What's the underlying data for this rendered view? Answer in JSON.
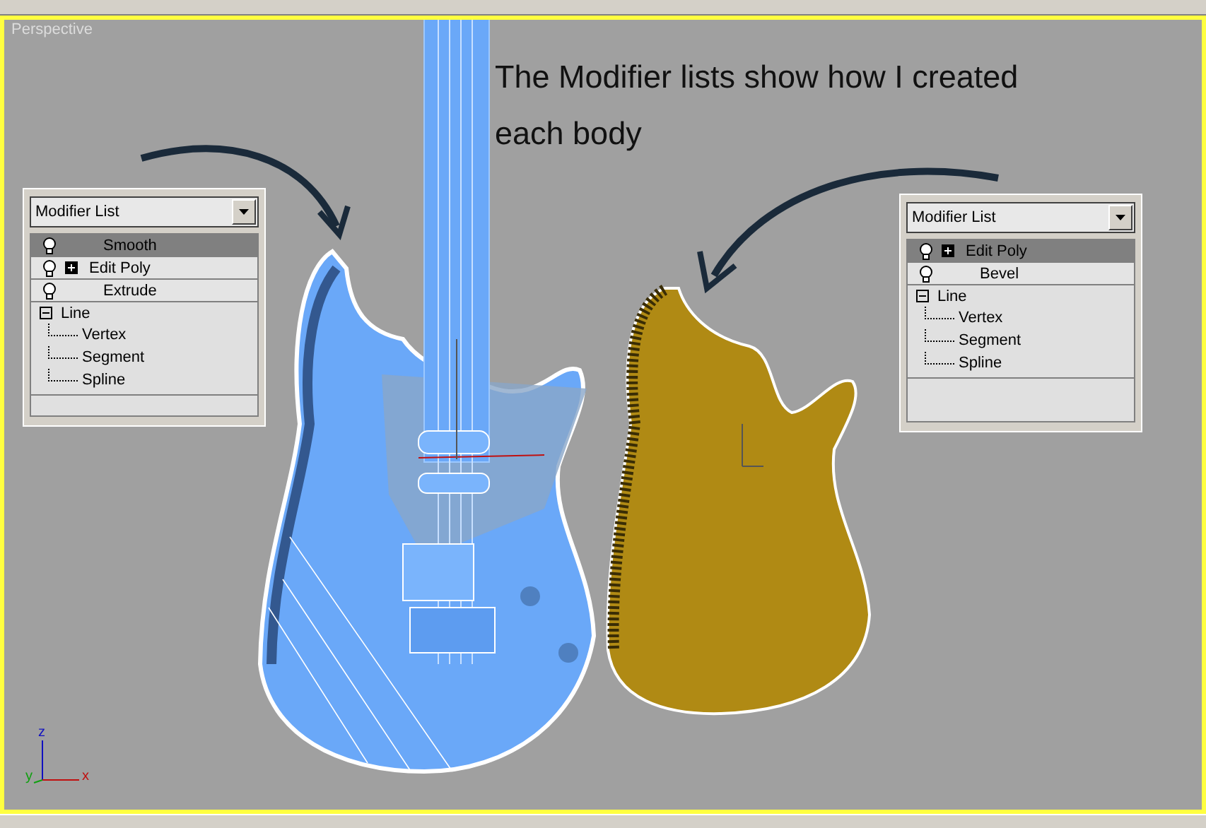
{
  "viewport": {
    "label": "Perspective",
    "active": true
  },
  "annotation": {
    "lines": [
      "The Modifier lists show how I created",
      "each body"
    ]
  },
  "gizmo": {
    "z": "z",
    "y": "y",
    "x": "x"
  },
  "panels": [
    {
      "dropdown": "Modifier List",
      "stack": [
        {
          "kind": "modifier",
          "label": "Smooth",
          "selected": true,
          "expandable": false
        },
        {
          "kind": "modifier",
          "label": "Edit Poly",
          "selected": false,
          "expandable": true
        },
        {
          "kind": "modifier",
          "label": "Extrude",
          "selected": false,
          "expandable": false
        },
        {
          "kind": "object",
          "label": "Line",
          "selected": false,
          "expanded": true,
          "children": [
            {
              "label": "Vertex"
            },
            {
              "label": "Segment"
            },
            {
              "label": "Spline"
            }
          ]
        }
      ]
    },
    {
      "dropdown": "Modifier List",
      "stack": [
        {
          "kind": "modifier",
          "label": "Edit Poly",
          "selected": true,
          "expandable": true
        },
        {
          "kind": "modifier",
          "label": "Bevel",
          "selected": false,
          "expandable": false
        },
        {
          "kind": "object",
          "label": "Line",
          "selected": false,
          "expanded": true,
          "children": [
            {
              "label": "Vertex"
            },
            {
              "label": "Segment"
            },
            {
              "label": "Spline"
            }
          ]
        }
      ]
    }
  ]
}
